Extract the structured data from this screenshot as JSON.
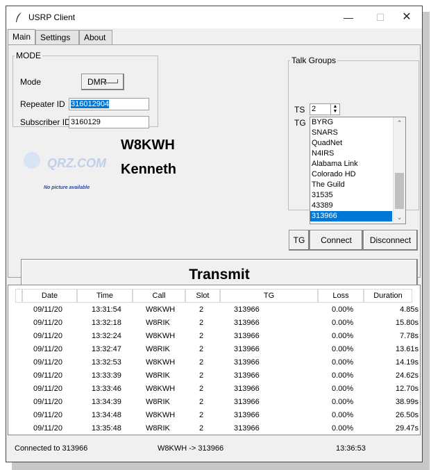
{
  "window": {
    "title": "USRP Client"
  },
  "tabs": [
    "Main",
    "Settings",
    "About"
  ],
  "mode_group": {
    "legend": "MODE",
    "mode_label": "Mode",
    "mode_value": "DMR",
    "repeater_label": "Repeater ID",
    "repeater_value": "316012904",
    "subscriber_label": "Subscriber ID",
    "subscriber_value": "3160129"
  },
  "profile": {
    "logo_text": "QRZ.COM",
    "no_picture": "No picture available",
    "callsign": "W8KWH",
    "name": "Kenneth"
  },
  "talk_groups": {
    "legend": "Talk Groups",
    "ts_label": "TS",
    "ts_value": "2",
    "tg_label": "TG",
    "items": [
      "BYRG",
      "SNARS",
      "QuadNet",
      "N4IRS",
      "Alabama Link",
      "Colorado HD",
      "The Guild",
      "31535",
      "43389",
      "313966"
    ],
    "selected": "313966",
    "tg_button": "TG",
    "connect_button": "Connect",
    "disconnect_button": "Disconnect"
  },
  "transmit": {
    "label": "Transmit"
  },
  "log": {
    "columns": [
      "Date",
      "Time",
      "Call",
      "Slot",
      "TG",
      "Loss",
      "Duration"
    ],
    "rows": [
      [
        "09/11/20",
        "13:31:54",
        "W8KWH",
        "2",
        "313966",
        "0.00%",
        "4.85s"
      ],
      [
        "09/11/20",
        "13:32:18",
        "W8RIK",
        "2",
        "313966",
        "0.00%",
        "15.80s"
      ],
      [
        "09/11/20",
        "13:32:24",
        "W8KWH",
        "2",
        "313966",
        "0.00%",
        "7.78s"
      ],
      [
        "09/11/20",
        "13:32:47",
        "W8RIK",
        "2",
        "313966",
        "0.00%",
        "13.61s"
      ],
      [
        "09/11/20",
        "13:32:53",
        "W8KWH",
        "2",
        "313966",
        "0.00%",
        "14.19s"
      ],
      [
        "09/11/20",
        "13:33:39",
        "W8RIK",
        "2",
        "313966",
        "0.00%",
        "24.62s"
      ],
      [
        "09/11/20",
        "13:33:46",
        "W8KWH",
        "2",
        "313966",
        "0.00%",
        "12.70s"
      ],
      [
        "09/11/20",
        "13:34:39",
        "W8RIK",
        "2",
        "313966",
        "0.00%",
        "38.99s"
      ],
      [
        "09/11/20",
        "13:34:48",
        "W8KWH",
        "2",
        "313966",
        "0.00%",
        "26.50s"
      ],
      [
        "09/11/20",
        "13:35:48",
        "W8RIK",
        "2",
        "313966",
        "0.00%",
        "29.47s"
      ]
    ]
  },
  "status": {
    "connection": "Connected to 313966",
    "traffic": "W8KWH -> 313966",
    "clock": "13:36:53"
  },
  "colors": {
    "selection": "#0078d7",
    "window_bg": "#f0f0f0"
  }
}
